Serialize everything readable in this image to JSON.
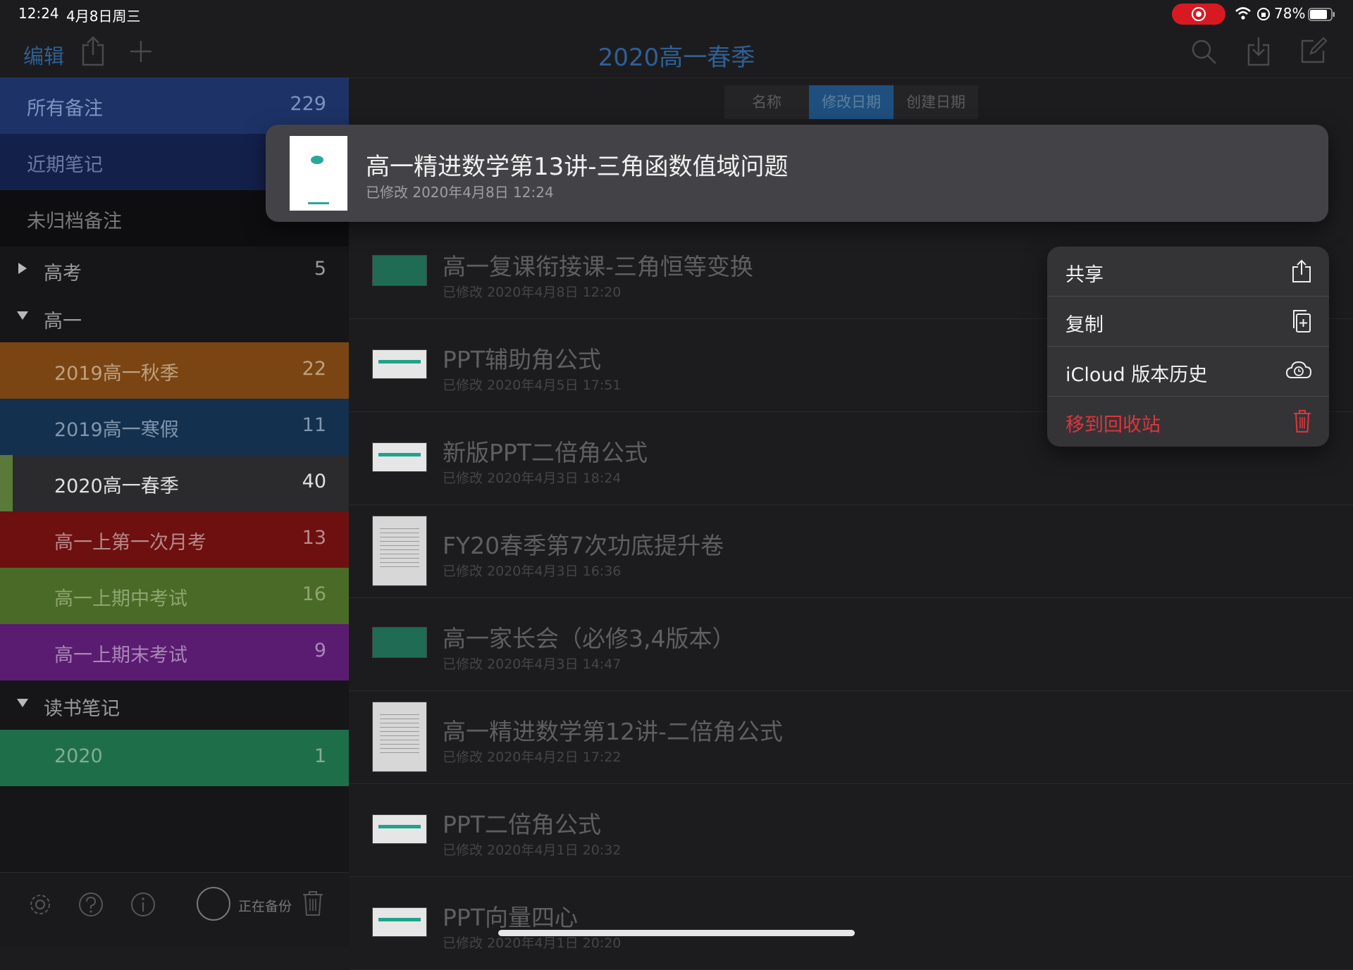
{
  "status_bar": {
    "time": "12:24",
    "date": "4月8日周三",
    "battery": "78%"
  },
  "header": {
    "edit_label": "编辑",
    "title": "2020高一春季"
  },
  "sidebar": {
    "rows": [
      {
        "label": "所有备注",
        "count": "229",
        "color": "#1d3368"
      },
      {
        "label": "近期笔记",
        "count": "",
        "color": "#13204a"
      },
      {
        "label": "未归档备注",
        "count": "",
        "color": "#0e0e10"
      },
      {
        "label": "高考",
        "count": "5",
        "color": "#161618"
      },
      {
        "label": "高一",
        "count": "",
        "color": "#161618"
      },
      {
        "label": "2019高一秋季",
        "count": "22",
        "color": "#7a4513"
      },
      {
        "label": "2019高一寒假",
        "count": "11",
        "color": "#14304f"
      },
      {
        "label": "2020高一春季",
        "count": "40",
        "color": "#2b2b2d"
      },
      {
        "label": "高一上第一次月考",
        "count": "13",
        "color": "#6e1010"
      },
      {
        "label": "高一上期中考试",
        "count": "16",
        "color": "#4a6b28"
      },
      {
        "label": "高一上期末考试",
        "count": "9",
        "color": "#5a1c70"
      },
      {
        "label": "读书笔记",
        "count": "",
        "color": "#161618"
      },
      {
        "label": "2020",
        "count": "1",
        "color": "#1f6e4a"
      }
    ],
    "footer": {
      "backup_label": "正在备份"
    }
  },
  "sort": {
    "options": [
      "名称",
      "修改日期",
      "创建日期"
    ],
    "selected": "修改日期"
  },
  "notes": [
    {
      "title": "高一复课衔接课-三角恒等变换",
      "subtitle": "已修改 2020年4月8日 12:20",
      "thumb": "photo"
    },
    {
      "title": "PPT辅助角公式",
      "subtitle": "已修改 2020年4月5日 17:51",
      "thumb": "ppt"
    },
    {
      "title": "新版PPT二倍角公式",
      "subtitle": "已修改 2020年4月3日 18:24",
      "thumb": "ppt"
    },
    {
      "title": "FY20春季第7次功底提升卷",
      "subtitle": "已修改 2020年4月3日 16:36",
      "thumb": "doc"
    },
    {
      "title": "高一家长会（必修3,4版本）",
      "subtitle": "已修改 2020年4月3日 14:47",
      "thumb": "photo"
    },
    {
      "title": "高一精进数学第12讲-二倍角公式",
      "subtitle": "已修改 2020年4月2日 17:22",
      "thumb": "doc"
    },
    {
      "title": "PPT二倍角公式",
      "subtitle": "已修改 2020年4月1日 20:32",
      "thumb": "ppt"
    },
    {
      "title": "PPT向量四心",
      "subtitle": "已修改 2020年4月1日 20:20",
      "thumb": "ppt"
    }
  ],
  "preview": {
    "title": "高一精进数学第13讲-三角函数值域问题",
    "subtitle": "已修改 2020年4月8日 12:24"
  },
  "context_menu": [
    {
      "label": "共享",
      "icon": "share-icon"
    },
    {
      "label": "复制",
      "icon": "duplicate-icon"
    },
    {
      "label": "iCloud 版本历史",
      "icon": "icloud-history-icon"
    },
    {
      "label": "移到回收站",
      "icon": "trash-icon"
    }
  ],
  "colors": {
    "accent": "#2f5f95",
    "danger": "#e0343a",
    "recording": "#d71a22"
  }
}
